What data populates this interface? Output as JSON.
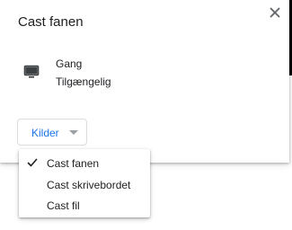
{
  "dialog": {
    "title": "Cast fanen",
    "close_icon": "close-icon"
  },
  "device": {
    "icon": "monitor-icon",
    "name": "Gang",
    "status": "Tilgængelig"
  },
  "sources": {
    "label": "Kilder",
    "caret_icon": "caret-down-icon",
    "accent_color": "#1a73e8"
  },
  "menu": {
    "items": [
      {
        "label": "Cast fanen",
        "checked": true
      },
      {
        "label": "Cast skrivebordet",
        "checked": false
      },
      {
        "label": "Cast fil",
        "checked": false
      }
    ]
  }
}
